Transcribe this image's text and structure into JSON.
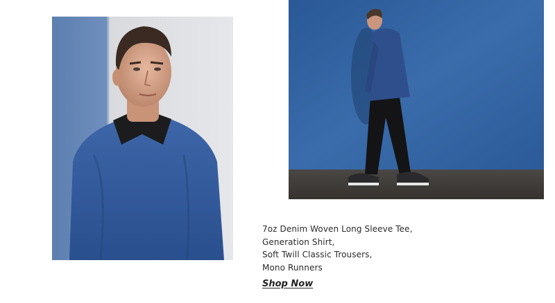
{
  "products": {
    "items": [
      "7oz Denim Woven Long Sleeve Tee,",
      "Generation Shirt,",
      "Soft Twill Classic Trousers,",
      "Mono Runners"
    ]
  },
  "cta": {
    "label": "Shop Now"
  },
  "colors": {
    "denim_blue": "#2f5f9c",
    "backdrop_grey": "#d9dbdf",
    "text": "#222222"
  }
}
